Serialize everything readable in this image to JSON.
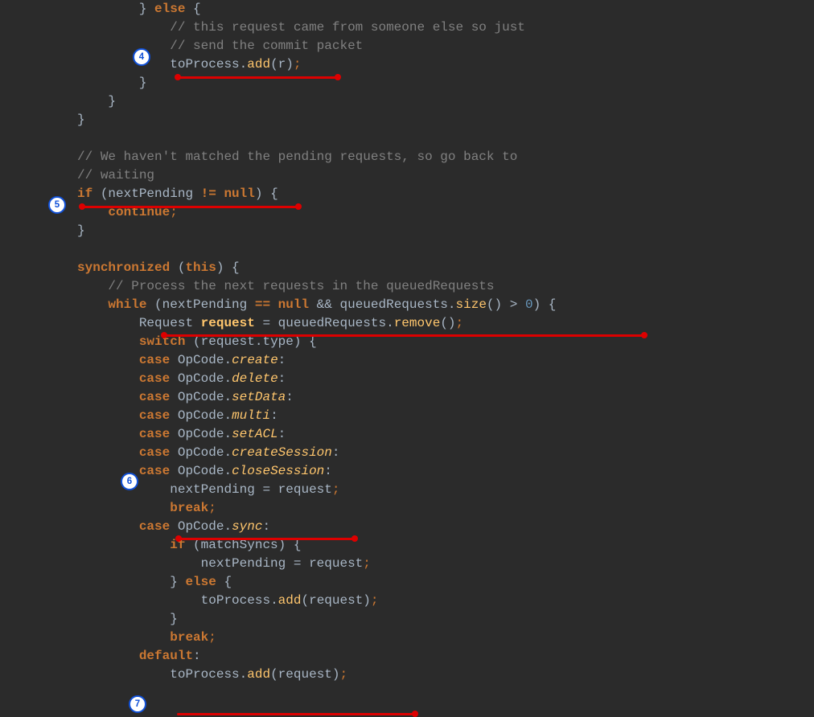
{
  "badges": {
    "b4": "4",
    "b5": "5",
    "b6": "6",
    "b7": "7"
  },
  "l1": {
    "brace": "} ",
    "else": "else",
    "space": " {"
  },
  "l2": {
    "comment": "// this request came from someone else so just"
  },
  "l3": {
    "comment": "// send the commit packet"
  },
  "l4": {
    "a": "toProcess",
    "dot": ".",
    "m": "add",
    "p": "(r)",
    "semi": ";"
  },
  "l5": {
    "b": "}"
  },
  "l6": {
    "b": "}"
  },
  "l7": {
    "b": "}"
  },
  "l9": {
    "comment": "// We haven't matched the pending requests, so go back to"
  },
  "l10": {
    "comment": "// waiting"
  },
  "l11": {
    "iff": "if",
    "open": " (nextPending ",
    "neq": "!=",
    "sp": " ",
    "nul": "null",
    "close": ") {"
  },
  "l12": {
    "cont": "continue",
    "semi": ";"
  },
  "l13": {
    "b": "}"
  },
  "l15": {
    "sync": "synchronized",
    "sp": " (",
    "thi": "this",
    "close": ") {"
  },
  "l16": {
    "comment": "// Process the next requests in the queuedRequests"
  },
  "l17": {
    "wh": "while",
    "a": " (nextPending ",
    "eq": "==",
    "sp1": " ",
    "nul": "null",
    "and": " && ",
    "q": "queuedRequests",
    "dot": ".",
    "size": "size",
    "paren": "() ",
    "gt": ">",
    "sp2": " ",
    "zero": "0",
    "close": ") {"
  },
  "l18": {
    "req": "Request ",
    "var": "request",
    "eq": " = queuedRequests",
    "dot": ".",
    "rem": "remove",
    "paren": "()",
    "semi": ";"
  },
  "l19": {
    "sw": "switch",
    "open": " (request",
    "dot": ".",
    "ty": "type) {"
  },
  "l20": {
    "case": "case",
    "sp": " OpCode",
    "dot": ".",
    "field": "create",
    "colon": ":"
  },
  "l21": {
    "case": "case",
    "sp": " OpCode",
    "dot": ".",
    "field": "delete",
    "colon": ":"
  },
  "l22": {
    "case": "case",
    "sp": " OpCode",
    "dot": ".",
    "field": "setData",
    "colon": ":"
  },
  "l23": {
    "case": "case",
    "sp": " OpCode",
    "dot": ".",
    "field": "multi",
    "colon": ":"
  },
  "l24": {
    "case": "case",
    "sp": " OpCode",
    "dot": ".",
    "field": "setACL",
    "colon": ":"
  },
  "l25": {
    "case": "case",
    "sp": " OpCode",
    "dot": ".",
    "field": "createSession",
    "colon": ":"
  },
  "l26": {
    "case": "case",
    "sp": " OpCode",
    "dot": ".",
    "field": "closeSession",
    "colon": ":"
  },
  "l27": {
    "a": "nextPending ",
    "eq": "=",
    "b": " request",
    "semi": ";"
  },
  "l28": {
    "br": "break",
    "semi": ";"
  },
  "l29": {
    "case": "case",
    "sp": " OpCode",
    "dot": ".",
    "field": "sync",
    "colon": ":"
  },
  "l30": {
    "iff": "if",
    "open": " (matchSyncs) {"
  },
  "l31": {
    "text": "nextPending = request",
    "semi": ";"
  },
  "l32": {
    "close": "} ",
    "el": "else",
    "open": " {"
  },
  "l33": {
    "a": "toProcess",
    "dot": ".",
    "m": "add",
    "p": "(request)",
    "semi": ";"
  },
  "l34": {
    "b": "}"
  },
  "l35": {
    "br": "break",
    "semi": ";"
  },
  "l36": {
    "def": "default",
    "colon": ":"
  },
  "l37": {
    "a": "toProcess",
    "dot": ".",
    "m": "add",
    "p": "(request)",
    "semi": ";"
  }
}
